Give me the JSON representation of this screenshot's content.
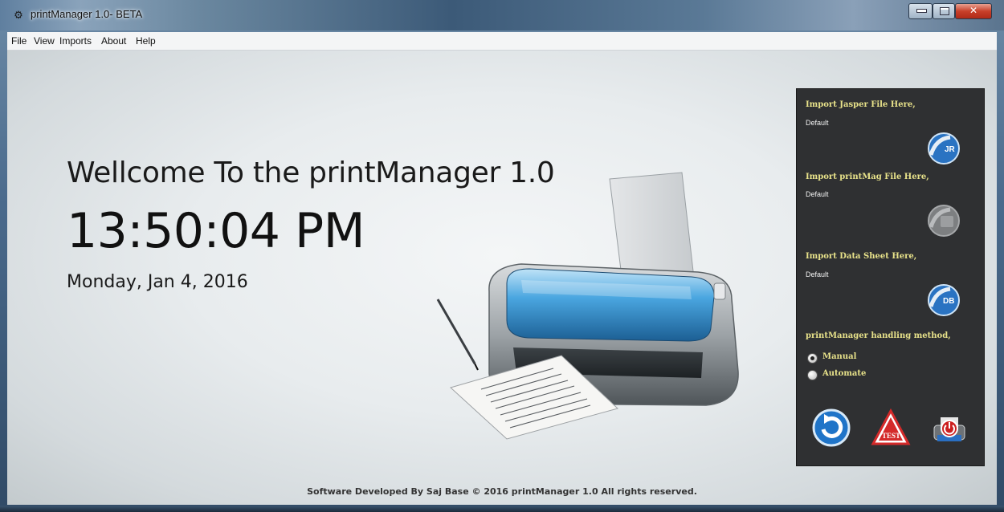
{
  "window": {
    "title": "printManager 1.0- BETA",
    "controls": {
      "close_glyph": "✕"
    }
  },
  "menu": {
    "items": [
      {
        "label": "File"
      },
      {
        "label": "View"
      },
      {
        "label": "Imports"
      },
      {
        "label": "About"
      },
      {
        "label": "Help"
      }
    ]
  },
  "main": {
    "welcome": "Wellcome To the printManager 1.0",
    "time": "13:50:04 PM",
    "date": "Monday, Jan 4, 2016"
  },
  "panel": {
    "jasper": {
      "label": "Import Jasper File Here,",
      "value": "Default",
      "icon": "jasper-import-icon"
    },
    "printmag": {
      "label": "Import printMag File Here,",
      "value": "Default",
      "icon": "printmag-import-icon"
    },
    "datasheet": {
      "label": "Import Data Sheet Here,",
      "value": "Default",
      "icon": "datasheet-import-icon",
      "badge": "DB"
    },
    "method": {
      "label": "printManager handling method,",
      "options": [
        {
          "label": "Manual",
          "selected": true
        },
        {
          "label": "Automate",
          "selected": false
        }
      ]
    },
    "buttons": {
      "refresh": "refresh-icon",
      "test": "TEST",
      "print": "print-power-icon"
    }
  },
  "footer": {
    "text": "Software Developed By Saj Base © 2016 printManager 1.0 All rights reserved."
  },
  "colors": {
    "panel_bg": "#2f3032",
    "panel_label": "#e8e28a",
    "accent_blue": "#1f74c8",
    "test_red": "#d42a2a"
  }
}
